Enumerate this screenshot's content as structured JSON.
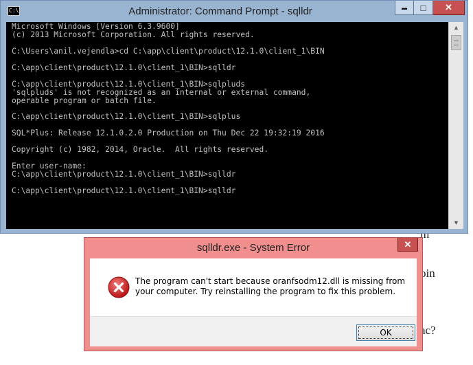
{
  "background_doc": {
    "fragment_1": "in",
    "fragment_2": "oin",
    "fragment_3": "ac?"
  },
  "cmd_window": {
    "title": "Administrator: Command Prompt - sqlldr",
    "icon_text": "C:\\",
    "buttons": {
      "minimize": "▬",
      "maximize": "□",
      "close": "✕"
    },
    "console_lines": [
      "Microsoft Windows [Version 6.3.9600]",
      "(c) 2013 Microsoft Corporation. All rights reserved.",
      "",
      "C:\\Users\\anil.vejendla>cd C:\\app\\client\\product\\12.1.0\\client_1\\BIN",
      "",
      "C:\\app\\client\\product\\12.1.0\\client_1\\BIN>sqlldr",
      "",
      "C:\\app\\client\\product\\12.1.0\\client_1\\BIN>sqlpluds",
      "'sqlpluds' is not recognized as an internal or external command,",
      "operable program or batch file.",
      "",
      "C:\\app\\client\\product\\12.1.0\\client_1\\BIN>sqlplus",
      "",
      "SQL*Plus: Release 12.1.0.2.0 Production on Thu Dec 22 19:32:19 2016",
      "",
      "Copyright (c) 1982, 2014, Oracle.  All rights reserved.",
      "",
      "Enter user-name:",
      "C:\\app\\client\\product\\12.1.0\\client_1\\BIN>sqlldr",
      "",
      "C:\\app\\client\\product\\12.1.0\\client_1\\BIN>sqlldr"
    ],
    "scrollbar": {
      "up_arrow": "▲",
      "down_arrow": "▼"
    }
  },
  "error_dialog": {
    "title": "sqlldr.exe - System Error",
    "close": "✕",
    "message": "The program can't start because oranfsodm12.dll is missing from your computer. Try reinstalling the program to fix this problem.",
    "ok_label": "OK"
  },
  "colors": {
    "cmd_frame": "#99b4d1",
    "console_bg": "#000000",
    "console_fg": "#c0c0c0",
    "dialog_frame": "#f18f8f",
    "close_red": "#c75050",
    "error_icon": "#d42020"
  }
}
